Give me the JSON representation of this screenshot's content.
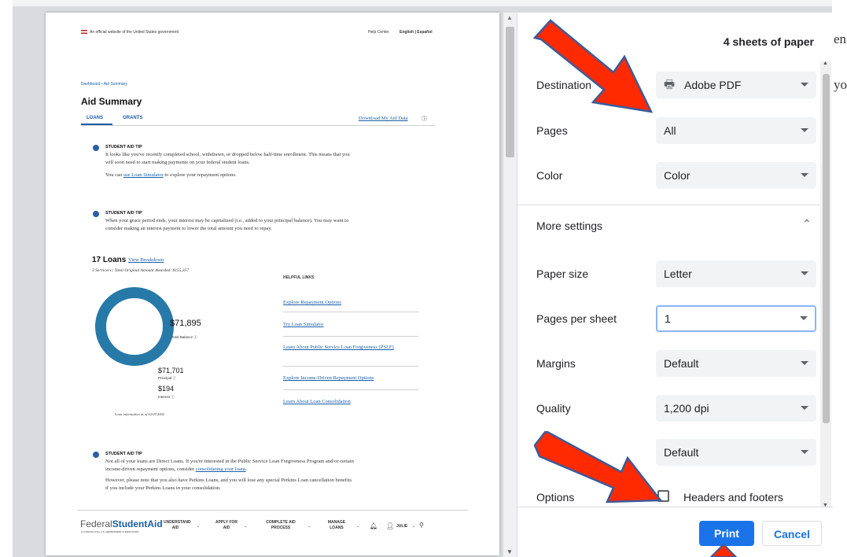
{
  "background_text": {
    "right_1": "en",
    "right_2": "yo"
  },
  "preview": {
    "official": "An official website of the United States government",
    "help_center": "Help Center",
    "language": "English | Español",
    "breadcrumb": "Dashboard  •  Aid Summary",
    "title": "Aid Summary",
    "tabs": [
      "LOANS",
      "GRANTS"
    ],
    "download": "Download My Aid Data",
    "tip_label": "STUDENT AID TIP",
    "tip1_line1": "It looks like you've recently completed school, withdrawn, or dropped below half-time enrollment. This means that you",
    "tip1_line2": "will soon need to start making payments on your federal student loans.",
    "tip1_pre": "You can",
    "tip1_link": "use Loan Simulator",
    "tip1_post": "to explore your repayment options.",
    "tip2_line1": "When your grace period ends, your interest may be capitalized (i.e., added to your principal balance). You may want to",
    "tip2_line2": "consider making an interest payment to lower the total amount you need to repay.",
    "loans_title": "17 Loans",
    "view_breakdown": "View Breakdown",
    "servicers": "3 Servicers | Total Original Amount Awarded: $155,357",
    "total_balance_value": "$71,895",
    "total_balance_label": "Total Balance ⓘ",
    "principal_value": "$71,701",
    "principal_label": "Principal ⓘ",
    "interest_value": "$194",
    "interest_label": "Interest ⓘ",
    "as_of": "Loan information as of 02/07/2002",
    "helpful_links_title": "HELPFUL LINKS",
    "helpful_links": [
      "Explore Repayment Options",
      "Try Loan Simulator",
      "Learn About Public Service Loan Forgiveness (PSLF)",
      "Explore Income-Driven Repayment Options",
      "Learn About Loan Consolidation"
    ],
    "tip3_line1": "Not all of your loans are Direct Loans. If you're interested in the Public Service Loan Forgiveness Program and/or certain",
    "tip3_line2_pre": "income-driven repayment options, consider",
    "tip3_link": "consolidating your loans",
    "tip3_line3": "However, please note that you also have Perkins Loans, and you will lose any special Perkins Loan cancellation benefits",
    "tip3_line4": "if you include your Perkins Loans in your consolidation.",
    "footer_logo_a": "Federal",
    "footer_logo_b": "StudentAid",
    "footer_logo_sub": "An OFFICE of the U.S. DEPARTMENT of EDUCATION",
    "footer_nav": [
      "UNDERSTAND AID",
      "APPLY FOR AID",
      "COMPLETE AID PROCESS",
      "MANAGE LOANS"
    ],
    "footer_user": "JULIE"
  },
  "print": {
    "sheets": "4 sheets of paper",
    "destination": {
      "label": "Destination",
      "value": "Adobe PDF"
    },
    "pages": {
      "label": "Pages",
      "value": "All"
    },
    "color": {
      "label": "Color",
      "value": "Color"
    },
    "more_settings": "More settings",
    "paper_size": {
      "label": "Paper size",
      "value": "Letter"
    },
    "pages_per_sheet": {
      "label": "Pages per sheet",
      "value": "1"
    },
    "margins": {
      "label": "Margins",
      "value": "Default"
    },
    "quality": {
      "label": "Quality",
      "value": "1,200 dpi"
    },
    "scale": {
      "value": "Default"
    },
    "options": {
      "label": "Options",
      "checkbox": "Headers and footers",
      "checked": false
    },
    "print_button": "Print",
    "cancel_button": "Cancel"
  },
  "colors": {
    "accent": "#1a73e8",
    "arrow": "#ff2a00",
    "donut": "#2779a7"
  }
}
